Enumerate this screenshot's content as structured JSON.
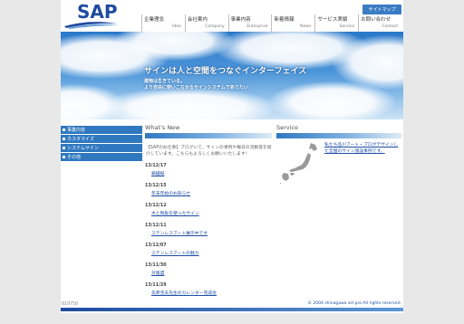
{
  "brand": {
    "logo_text": "SAP",
    "accent": "#1f4b9e",
    "nav_blue": "#2f78c0"
  },
  "header": {
    "sitemap_label": "サイトマップ",
    "nav": [
      {
        "label": "企業理念",
        "sub": "Idea"
      },
      {
        "label": "会社案内",
        "sub": "Company"
      },
      {
        "label": "事業内容",
        "sub": "Enterprise"
      },
      {
        "label": "新着情報",
        "sub": "News"
      },
      {
        "label": "サービス実績",
        "sub": "Service"
      },
      {
        "label": "お問い合わせ",
        "sub": "Contact"
      }
    ]
  },
  "hero": {
    "title": "サインは人と空間をつなぐインターフェイス",
    "sub1": "建物は生きている。",
    "sub2": "より自由に使いこなせるサインシステムでありたい"
  },
  "sidebar": {
    "items": [
      {
        "label": "事業内容"
      },
      {
        "label": "カスタマイズ"
      },
      {
        "label": "システムサイン"
      },
      {
        "label": "その他"
      }
    ]
  },
  "news": {
    "heading": "What's New",
    "intro": "【SAPのお仕事】ブログにて、サインの事例や毎日の活動等を紹介しています。こちらもよろしくお願いいたします！",
    "items": [
      {
        "date": "13/12/17",
        "title": "鎖鋸紙"
      },
      {
        "date": "13/12/15",
        "title": "年末年始のお知らせ"
      },
      {
        "date": "13/12/12",
        "title": "木と陶板を使ったサイン"
      },
      {
        "date": "13/12/11",
        "title": "ステンレスアート展示中です"
      },
      {
        "date": "13/12/07",
        "title": "ステンレスアートの魅力"
      },
      {
        "date": "13/11/30",
        "title": "対連盟"
      },
      {
        "date": "13/11/29",
        "title": "氏原克夫先生のカレンダー完成会"
      }
    ]
  },
  "service": {
    "heading": "Service",
    "text": "私たち品川アート・プロがデザインした全国のサイン施設事例です。"
  },
  "footer": {
    "counter": "019750",
    "copyright": "© 2004 shinagawa art pro All rights reserved."
  }
}
